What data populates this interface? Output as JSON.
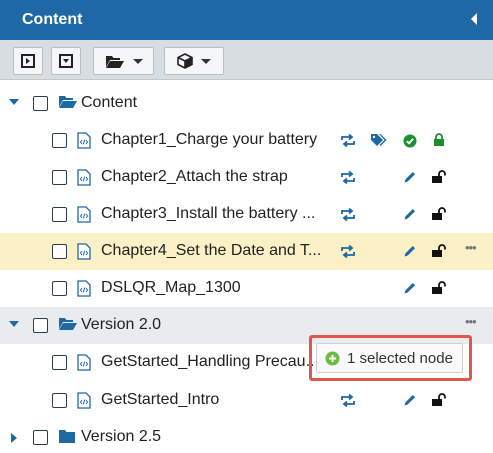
{
  "panel": {
    "title": "Content"
  },
  "toolbar": {
    "buttons": [
      {
        "name": "expand-all",
        "icon": "expand-right-square-icon"
      },
      {
        "name": "collapse-all",
        "icon": "expand-down-square-icon"
      },
      {
        "name": "folder-menu",
        "icon": "folder-open-icon"
      },
      {
        "name": "package-menu",
        "icon": "cube-icon"
      }
    ]
  },
  "tree": {
    "rows": [
      {
        "label": "Content",
        "type": "folder"
      },
      {
        "label": "Chapter1_Charge your battery",
        "type": "topic"
      },
      {
        "label": "Chapter2_Attach the strap",
        "type": "topic"
      },
      {
        "label": "Chapter3_Install the battery ...",
        "type": "topic"
      },
      {
        "label": "Chapter4_Set the Date and T...",
        "type": "topic"
      },
      {
        "label": "DSLQR_Map_1300",
        "type": "topic"
      },
      {
        "label": "Version 2.0",
        "type": "folder"
      },
      {
        "label": "GetStarted_Handling Precau...",
        "type": "topic"
      },
      {
        "label": "GetStarted_Intro",
        "type": "topic"
      },
      {
        "label": "Version 2.5",
        "type": "folder"
      }
    ],
    "more_glyph": "•••"
  },
  "tooltip": {
    "text": "1 selected node"
  },
  "colors": {
    "header": "#1e68a6",
    "accent": "#1e68a6",
    "highlight_row": "#fcf0c6",
    "status_green": "#1c8f2e",
    "callout": "#e2574c"
  }
}
